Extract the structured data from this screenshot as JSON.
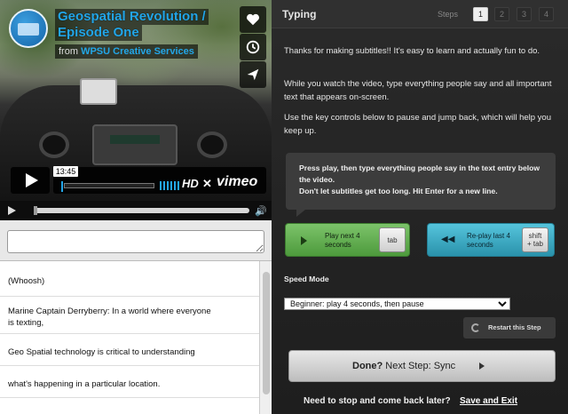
{
  "video": {
    "title_line1": "Geospatial Revolution /",
    "title_line2": "Episode One",
    "byline_prefix": "from",
    "byline_author": "WPSU Creative Services",
    "time_tooltip": "13:45",
    "hd_label": "HD",
    "vimeo_label": "vimeo",
    "icons": [
      "heart-icon",
      "clock-icon",
      "send-icon"
    ]
  },
  "entry": {
    "value": "",
    "placeholder": ""
  },
  "transcript": [
    "(Whoosh)",
    "Marine Captain Derryberry: In a world where everyone",
    "is texting,",
    "Geo Spatial technology is critical to understanding",
    "what's happening in a particular location."
  ],
  "panel": {
    "title": "Typing",
    "steps_label": "Steps",
    "steps": [
      "1",
      "2",
      "3",
      "4"
    ],
    "active_step": 1,
    "intro1": "Thanks for making subtitles!! It's easy to learn and actually fun to do.",
    "intro2": "While you watch the video, type everything people say and all important text that appears on-screen.",
    "intro3": "Use the key controls below to pause and jump back, which will help you keep up.",
    "tip_line1": "Press play, then type everything people say in the text entry below the video.",
    "tip_line2": "Don't let subtitles get too long. Hit Enter for a new line.",
    "play_label": "Play next 4 seconds",
    "play_key": "tab",
    "replay_label": "Re-play last 4 seconds",
    "replay_key_line1": "shift",
    "replay_key_line2": "+ tab",
    "speed_label": "Speed Mode",
    "speed_selected": "Beginner: play 4 seconds, then pause",
    "restart_label": "Restart this Step",
    "done_bold": "Done?",
    "done_rest": " Next Step: Sync",
    "stop_text": "Need to stop and come back later?",
    "save_exit": "Save and Exit"
  }
}
